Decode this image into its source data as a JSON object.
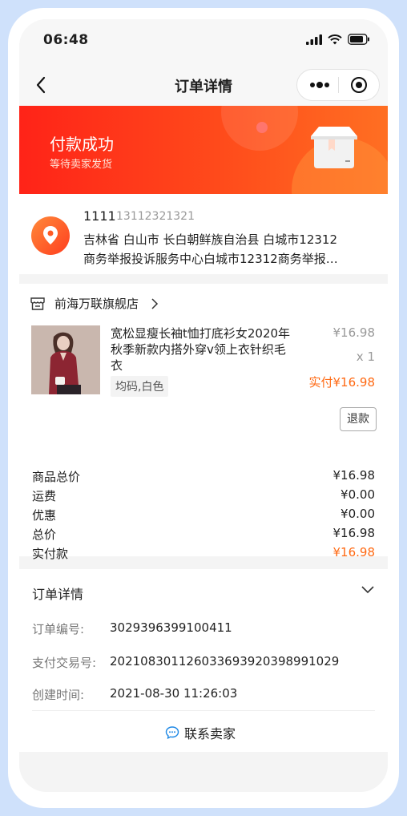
{
  "status_bar": {
    "time": "06:48"
  },
  "nav": {
    "title": "订单详情"
  },
  "banner": {
    "title": "付款成功",
    "subtitle": "等待卖家发货"
  },
  "address": {
    "name": "1111",
    "phone": "13112321321",
    "line1": "吉林省 白山市 长白朝鲜族自治县 白城市12312",
    "line2": "商务举报投诉服务中心白城市12312商务举报…"
  },
  "shop": {
    "name": "前海万联旗舰店"
  },
  "product": {
    "title_line1": "宽松显瘦长袖t恤打底衫女2020年",
    "title_line2": "秋季新款内搭外穿v领上衣针织毛",
    "title_line3": "衣",
    "sku": "均码,白色",
    "price": "¥16.98",
    "quantity": "x 1",
    "paid_label": "实付¥16.98",
    "refund_button": "退款"
  },
  "summary": [
    {
      "label": "商品总价",
      "value": "¥16.98"
    },
    {
      "label": "运费",
      "value": "¥0.00"
    },
    {
      "label": "优惠",
      "value": "¥0.00"
    },
    {
      "label": "总价",
      "value": "¥16.98"
    },
    {
      "label": "实付款",
      "value": "¥16.98"
    }
  ],
  "order_details": {
    "title": "订单详情",
    "order_no_label": "订单编号:",
    "order_no": "3029396399100411",
    "trade_no_label": "支付交易号:",
    "trade_no": "20210830112603369392039899102 9",
    "created_label": "创建时间:",
    "created": "2021-08-30 11:26:03",
    "contact_seller": "联系卖家"
  },
  "colors": {
    "accent": "#ff6a14",
    "banner_start": "#ff2318",
    "banner_end": "#ff6f22"
  }
}
